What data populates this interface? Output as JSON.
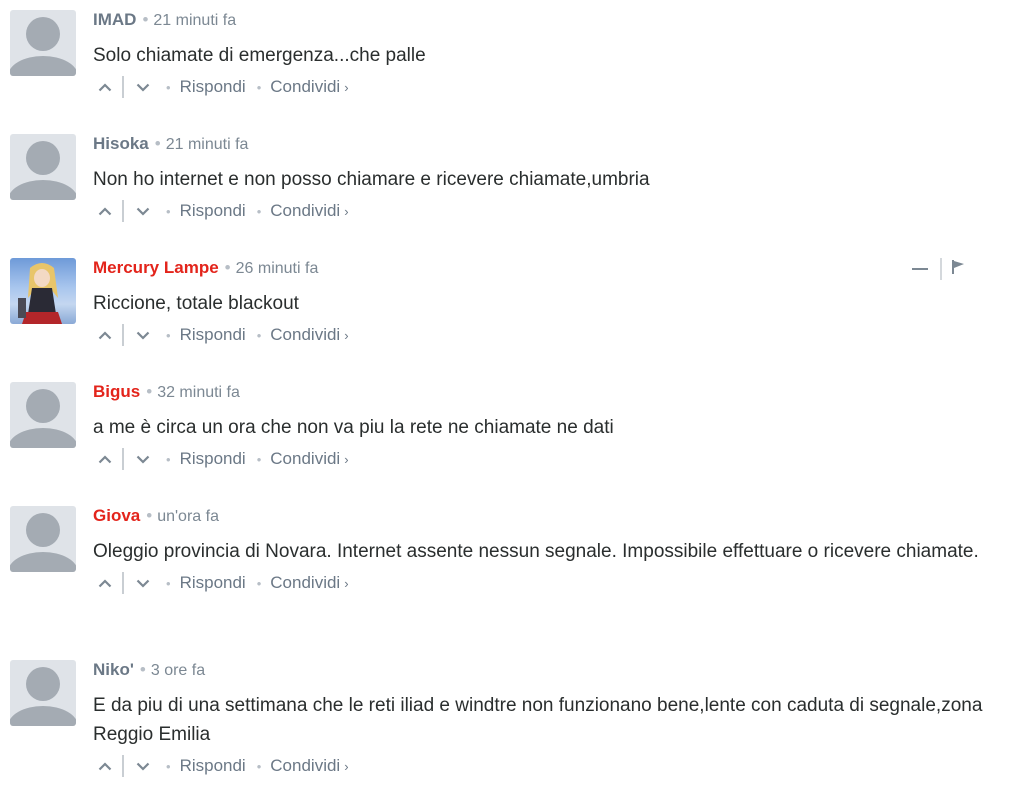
{
  "actions": {
    "reply_label": "Rispondi",
    "share_label": "Condividi",
    "share_chevron": "›",
    "separator": "•",
    "upvote_icon": "chevron-up-icon",
    "downvote_icon": "chevron-down-icon"
  },
  "colors": {
    "author_default": "#6b7886",
    "author_highlight": "#e3241b",
    "text": "#2a2e2e",
    "meta": "#7c8893"
  },
  "comments": [
    {
      "author": "IMAD",
      "author_highlight": false,
      "time": "21 minuti fa",
      "text": "Solo chiamate di emergenza...che palle",
      "avatar": "default"
    },
    {
      "author": "Hisoka",
      "author_highlight": false,
      "time": "21 minuti fa",
      "text": "Non ho internet e non posso chiamare e ricevere chiamate,umbria",
      "avatar": "default"
    },
    {
      "author": "Mercury Lampe",
      "author_highlight": true,
      "time": "26 minuti fa",
      "text": "Riccione, totale blackout",
      "avatar": "custom",
      "show_tools": true
    },
    {
      "author": "Bigus",
      "author_highlight": true,
      "time": "32 minuti fa",
      "text": "a me è circa un ora che non va piu la rete ne chiamate ne dati",
      "avatar": "default"
    },
    {
      "author": "Giova",
      "author_highlight": true,
      "time": "un'ora fa",
      "text": "Oleggio provincia di Novara. Internet assente nessun segnale. Impossibile effettuare o ricevere chiamate.",
      "avatar": "default"
    },
    {
      "author": "Niko'",
      "author_highlight": false,
      "time": "3 ore fa",
      "text": "E da piu di una settimana che le reti iliad e windtre non funzionano bene,lente con caduta di segnale,zona Reggio Emilia",
      "avatar": "default"
    }
  ]
}
